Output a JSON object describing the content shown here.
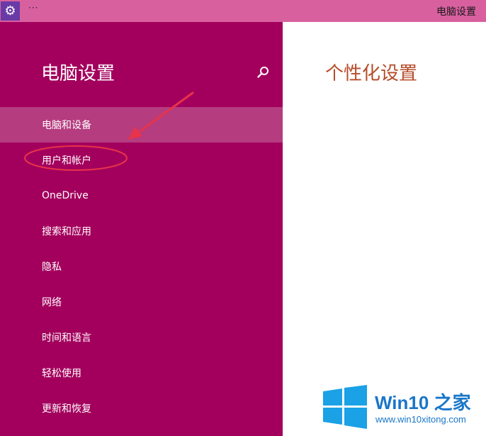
{
  "titlebar": {
    "app_icon": "gear-icon",
    "dots": "···",
    "title": "电脑设置"
  },
  "sidebar": {
    "title": "电脑设置",
    "search_icon": "search-icon",
    "items": [
      {
        "label": "电脑和设备",
        "selected": true
      },
      {
        "label": "用户和帐户",
        "selected": false,
        "annotated": true
      },
      {
        "label": "OneDrive",
        "selected": false
      },
      {
        "label": "搜索和应用",
        "selected": false
      },
      {
        "label": "隐私",
        "selected": false
      },
      {
        "label": "网络",
        "selected": false
      },
      {
        "label": "时间和语言",
        "selected": false
      },
      {
        "label": "轻松使用",
        "selected": false
      },
      {
        "label": "更新和恢复",
        "selected": false
      }
    ]
  },
  "main": {
    "title": "个性化设置"
  },
  "watermark": {
    "brand_win": "Win10",
    "brand_suffix": "之家",
    "url": "www.win10xitong.com"
  },
  "colors": {
    "titlebar": "#d8609f",
    "sidebar": "#a3005d",
    "selected_item": "#b53c7f",
    "main_title": "#b64c2a",
    "annotation": "#e8334a",
    "brand": "#1976c8"
  }
}
